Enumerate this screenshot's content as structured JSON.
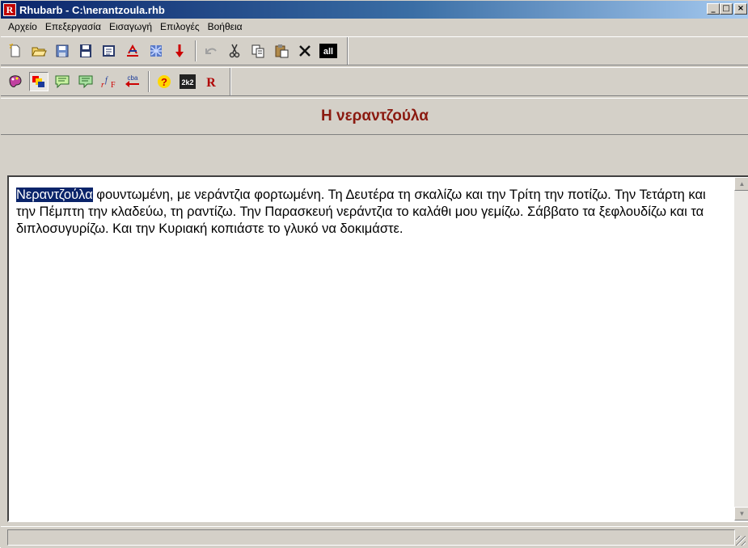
{
  "window": {
    "app_icon_letter": "R",
    "title": "Rhubarb - C:\\nerantzoula.rhb",
    "controls": {
      "minimize": "_",
      "maximize": "□",
      "close": "×"
    }
  },
  "menu": [
    "Αρχείο",
    "Επεξεργασία",
    "Εισαγωγή",
    "Επιλογές",
    "Βοήθεια"
  ],
  "toolbar1": {
    "icons": [
      "new-icon",
      "open-icon",
      "save-icon",
      "save-as-icon",
      "export-icon",
      "print-icon",
      "color-icon",
      "down-arrow-icon",
      "undo-icon",
      "cut-icon",
      "copy-icon",
      "paste-icon",
      "delete-icon",
      "all-icon"
    ],
    "all_label": "all"
  },
  "toolbar2": {
    "icons": [
      "palette-icon",
      "layers-icon",
      "speech-icon",
      "speech2-icon",
      "font-icon",
      "reverse-icon",
      "help-icon",
      "grid-icon",
      "rhubarb-icon"
    ],
    "reverse_label": "cba",
    "grid_label": "2k2",
    "rhubarb_label": "R"
  },
  "heading": "Η νεραντζούλα",
  "editor": {
    "selected_word": "Νεραντζούλα",
    "text": " φουντωμένη, με νεράντζια φορτωμένη. Τη Δευτέρα τη σκαλίζω και την Τρίτη την ποτίζω. Την Τετάρτη και την Πέμπτη την κλαδεύω, τη ραντίζω. Την Παρασκευή νεράντζια το καλάθι μου γεμίζω. Σάββατο τα ξεφλουδίζω και τα διπλοσυγυρίζω. Και την Κυριακή κοπιάστε το γλυκό να δοκιμάστε."
  },
  "colors": {
    "title_gradient_start": "#0a246a",
    "heading_text": "#8b1a10",
    "selection_bg": "#0a246a",
    "chrome": "#d4d0c8"
  }
}
